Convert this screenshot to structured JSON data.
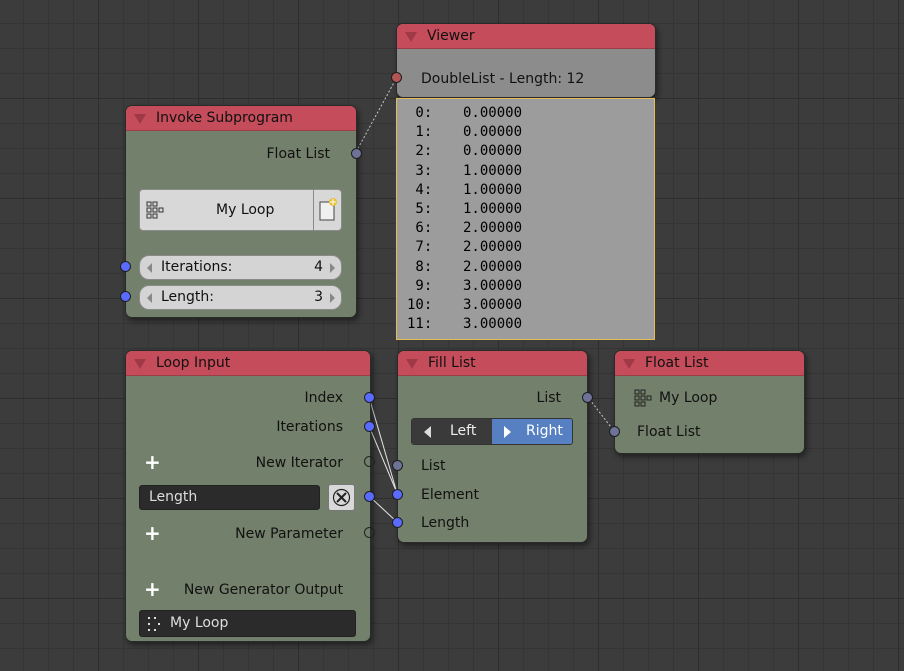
{
  "viewer": {
    "title": "Viewer",
    "info": "DoubleList - Length: 12",
    "rows": [
      {
        "i": " 0:",
        "v": "0.00000"
      },
      {
        "i": " 1:",
        "v": "0.00000"
      },
      {
        "i": " 2:",
        "v": "0.00000"
      },
      {
        "i": " 3:",
        "v": "1.00000"
      },
      {
        "i": " 4:",
        "v": "1.00000"
      },
      {
        "i": " 5:",
        "v": "1.00000"
      },
      {
        "i": " 6:",
        "v": "2.00000"
      },
      {
        "i": " 7:",
        "v": "2.00000"
      },
      {
        "i": " 8:",
        "v": "2.00000"
      },
      {
        "i": " 9:",
        "v": "3.00000"
      },
      {
        "i": "10:",
        "v": "3.00000"
      },
      {
        "i": "11:",
        "v": "3.00000"
      }
    ]
  },
  "invoke": {
    "title": "Invoke Subprogram",
    "output": "Float List",
    "program": "My Loop",
    "iterations_label": "Iterations:",
    "iterations_value": "4",
    "length_label": "Length:",
    "length_value": "3"
  },
  "loop_input": {
    "title": "Loop Input",
    "index": "Index",
    "iterations": "Iterations",
    "new_iterator": "New Iterator",
    "param_value": "Length",
    "new_parameter": "New Parameter",
    "new_generator_output": "New Generator Output",
    "program_name": "My Loop"
  },
  "fill_list": {
    "title": "Fill List",
    "output": "List",
    "left_label": "Left",
    "right_label": "Right",
    "active_side": "Right",
    "inputs": [
      "List",
      "Element",
      "Length"
    ]
  },
  "float_list": {
    "title": "Float List",
    "program": "My Loop",
    "input": "Float List"
  },
  "icons": [
    "collapse-triangle-icon",
    "subprogram-grid-icon",
    "new-file-icon",
    "plus-icon",
    "remove-x-icon",
    "arrow-left-icon",
    "arrow-right-icon"
  ],
  "colors": {
    "header": "#c54c5a",
    "node_body": "#73806b",
    "socket_blue": "#5a6cff",
    "socket_grey": "#6d7296",
    "socket_red": "#b25555",
    "selected_button": "#5680c2",
    "viewer_border": "#e2bf55"
  }
}
